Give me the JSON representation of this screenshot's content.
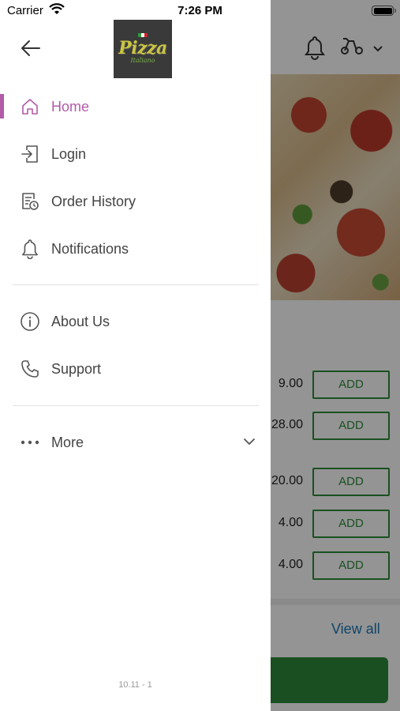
{
  "status_bar": {
    "carrier": "Carrier",
    "time": "7:26 PM"
  },
  "drawer": {
    "logo": {
      "word": "Pizza",
      "sub": "Italiano"
    },
    "items": [
      {
        "label": "Home",
        "icon": "home-icon",
        "active": true
      },
      {
        "label": "Login",
        "icon": "login-icon"
      },
      {
        "label": "Order History",
        "icon": "order-history-icon"
      },
      {
        "label": "Notifications",
        "icon": "bell-icon"
      }
    ],
    "secondary_items": [
      {
        "label": "About Us",
        "icon": "info-icon"
      },
      {
        "label": "Support",
        "icon": "phone-icon"
      }
    ],
    "more": {
      "label": "More",
      "icon": "more-dots-icon"
    },
    "version": "10.11 - 1"
  },
  "background": {
    "prices": [
      "9.00",
      "28.00",
      "20.00",
      "4.00",
      "4.00"
    ],
    "add_label": "ADD",
    "view_all": "View all"
  },
  "colors": {
    "accent": "#b35aa8",
    "green": "#2e8b3a",
    "link": "#1a78b4"
  }
}
